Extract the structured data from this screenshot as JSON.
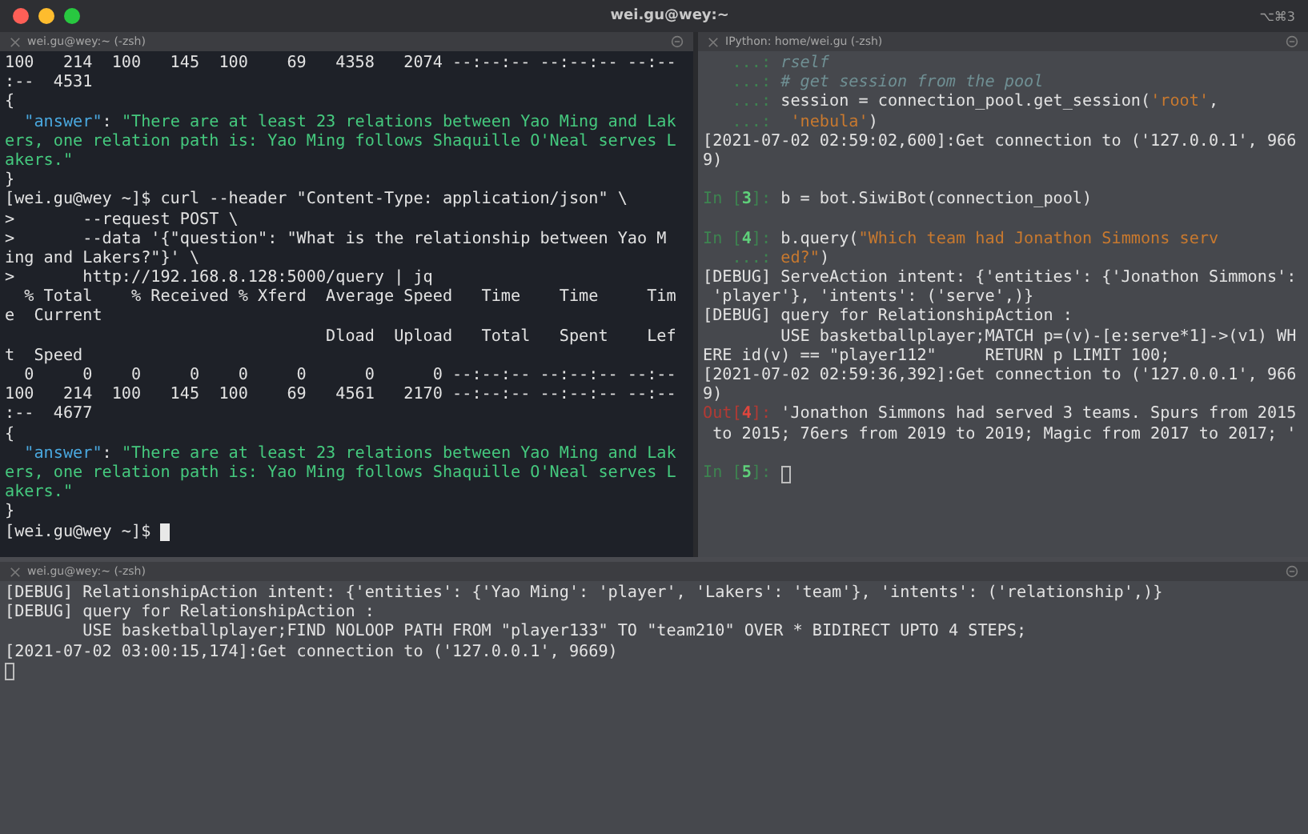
{
  "window": {
    "title": "wei.gu@wey:~",
    "shortcut": "⌥⌘3"
  },
  "panes": [
    {
      "kind": "dark",
      "tab_title": "wei.gu@wey:~ (-zsh)",
      "lines": [
        {
          "segments": [
            {
              "kind": "plain",
              "text": "100   214  100   145  100    69   4358   2074 --:--:-- --:--:-- --:--"
            }
          ]
        },
        {
          "segments": [
            {
              "kind": "plain",
              "text": ":--  4531"
            }
          ]
        },
        {
          "segments": [
            {
              "kind": "plain",
              "text": "{"
            }
          ]
        },
        {
          "segments": [
            {
              "kind": "key",
              "text": "  \"answer\""
            },
            {
              "kind": "plain",
              "text": ": "
            },
            {
              "kind": "string",
              "text": "\"There are at least 23 relations between Yao Ming and Lak"
            }
          ]
        },
        {
          "segments": [
            {
              "kind": "string",
              "text": "ers, one relation path is: Yao Ming follows Shaquille O'Neal serves L"
            }
          ]
        },
        {
          "segments": [
            {
              "kind": "string",
              "text": "akers.\""
            }
          ]
        },
        {
          "segments": [
            {
              "kind": "plain",
              "text": "}"
            }
          ]
        },
        {
          "segments": [
            {
              "kind": "plain",
              "text": "[wei.gu@wey ~]$ curl --header \"Content-Type: application/json\" \\"
            }
          ]
        },
        {
          "segments": [
            {
              "kind": "plain",
              "text": ">       --request POST \\"
            }
          ]
        },
        {
          "segments": [
            {
              "kind": "plain",
              "text": ">       --data '{\"question\": \"What is the relationship between Yao M"
            }
          ]
        },
        {
          "segments": [
            {
              "kind": "plain",
              "text": "ing and Lakers?\"}' \\"
            }
          ]
        },
        {
          "segments": [
            {
              "kind": "plain",
              "text": ">       http://192.168.8.128:5000/query | jq"
            }
          ]
        },
        {
          "segments": [
            {
              "kind": "plain",
              "text": "  % Total    % Received % Xferd  Average Speed   Time    Time     Tim"
            }
          ]
        },
        {
          "segments": [
            {
              "kind": "plain",
              "text": "e  Current"
            }
          ]
        },
        {
          "segments": [
            {
              "kind": "plain",
              "text": "                                 Dload  Upload   Total   Spent    Lef"
            }
          ]
        },
        {
          "segments": [
            {
              "kind": "plain",
              "text": "t  Speed"
            }
          ]
        },
        {
          "segments": [
            {
              "kind": "plain",
              "text": "  0     0    0     0    0     0      0      0 --:--:-- --:--:-- --:--"
            }
          ]
        },
        {
          "segments": [
            {
              "kind": "plain",
              "text": "100   214  100   145  100    69   4561   2170 --:--:-- --:--:-- --:--"
            }
          ]
        },
        {
          "segments": [
            {
              "kind": "plain",
              "text": ":--  4677"
            }
          ]
        },
        {
          "segments": [
            {
              "kind": "plain",
              "text": "{"
            }
          ]
        },
        {
          "segments": [
            {
              "kind": "key",
              "text": "  \"answer\""
            },
            {
              "kind": "plain",
              "text": ": "
            },
            {
              "kind": "string",
              "text": "\"There are at least 23 relations between Yao Ming and Lak"
            }
          ]
        },
        {
          "segments": [
            {
              "kind": "string",
              "text": "ers, one relation path is: Yao Ming follows Shaquille O'Neal serves L"
            }
          ]
        },
        {
          "segments": [
            {
              "kind": "string",
              "text": "akers.\""
            }
          ]
        },
        {
          "segments": [
            {
              "kind": "plain",
              "text": "}"
            }
          ]
        },
        {
          "kind": "block_cursor",
          "segments": [
            {
              "kind": "plain",
              "text": "[wei.gu@wey ~]$ "
            }
          ]
        }
      ]
    },
    {
      "kind": "gray",
      "tab_title": "IPython: home/wei.gu (-zsh)",
      "lines": [
        {
          "segments": [
            {
              "kind": "prompt",
              "text": "   ...: "
            },
            {
              "kind": "comment",
              "text": "rself"
            }
          ]
        },
        {
          "segments": [
            {
              "kind": "prompt",
              "text": "   ...: "
            },
            {
              "kind": "comment",
              "text": "# get session from the pool"
            }
          ]
        },
        {
          "segments": [
            {
              "kind": "prompt",
              "text": "   ...: "
            },
            {
              "kind": "plain",
              "text": "session = connection_pool.get_session("
            },
            {
              "kind": "literal",
              "text": "'root'"
            },
            {
              "kind": "plain",
              "text": ","
            }
          ]
        },
        {
          "segments": [
            {
              "kind": "prompt",
              "text": "   ...:  "
            },
            {
              "kind": "literal",
              "text": "'nebula'"
            },
            {
              "kind": "plain",
              "text": ")"
            }
          ]
        },
        {
          "segments": [
            {
              "kind": "plain",
              "text": "[2021-07-02 02:59:02,600]:Get connection to ('127.0.0.1', 966"
            }
          ]
        },
        {
          "segments": [
            {
              "kind": "plain",
              "text": "9)"
            }
          ]
        },
        {
          "kind": "blank"
        },
        {
          "segments": [
            {
              "kind": "prompt",
              "text": "In ["
            },
            {
              "kind": "prompt_num",
              "text": "3"
            },
            {
              "kind": "prompt",
              "text": "]: "
            },
            {
              "kind": "plain",
              "text": "b = bot.SiwiBot(connection_pool)"
            }
          ]
        },
        {
          "kind": "blank"
        },
        {
          "segments": [
            {
              "kind": "prompt",
              "text": "In ["
            },
            {
              "kind": "prompt_num",
              "text": "4"
            },
            {
              "kind": "prompt",
              "text": "]: "
            },
            {
              "kind": "plain",
              "text": "b.query("
            },
            {
              "kind": "literal",
              "text": "\"Which team had Jonathon Simmons serv"
            }
          ]
        },
        {
          "segments": [
            {
              "kind": "prompt",
              "text": "   ...: "
            },
            {
              "kind": "literal",
              "text": "ed?\""
            },
            {
              "kind": "plain",
              "text": ")"
            }
          ]
        },
        {
          "segments": [
            {
              "kind": "plain",
              "text": "[DEBUG] ServeAction intent: {'entities': {'Jonathon Simmons':"
            }
          ]
        },
        {
          "segments": [
            {
              "kind": "plain",
              "text": " 'player'}, 'intents': ('serve',)}"
            }
          ]
        },
        {
          "segments": [
            {
              "kind": "plain",
              "text": "[DEBUG] query for RelationshipAction :"
            }
          ]
        },
        {
          "segments": [
            {
              "kind": "plain",
              "text": "        USE basketballplayer;MATCH p=(v)-[e:serve*1]->(v1) WH"
            }
          ]
        },
        {
          "segments": [
            {
              "kind": "plain",
              "text": "ERE id(v) == \"player112\"     RETURN p LIMIT 100;"
            }
          ]
        },
        {
          "segments": [
            {
              "kind": "plain",
              "text": "[2021-07-02 02:59:36,392]:Get connection to ('127.0.0.1', 966"
            }
          ]
        },
        {
          "segments": [
            {
              "kind": "plain",
              "text": "9)"
            }
          ]
        },
        {
          "segments": [
            {
              "kind": "out",
              "text": "Out["
            },
            {
              "kind": "out_num",
              "text": "4"
            },
            {
              "kind": "out",
              "text": "]: "
            },
            {
              "kind": "plain",
              "text": "'Jonathon Simmons had served 3 teams. Spurs from 2015"
            }
          ]
        },
        {
          "segments": [
            {
              "kind": "plain",
              "text": " to 2015; 76ers from 2019 to 2019; Magic from 2017 to 2017; '"
            }
          ]
        },
        {
          "kind": "blank"
        },
        {
          "kind": "outline_cursor",
          "segments": [
            {
              "kind": "prompt",
              "text": "In ["
            },
            {
              "kind": "prompt_num",
              "text": "5"
            },
            {
              "kind": "prompt",
              "text": "]: "
            }
          ]
        }
      ]
    },
    {
      "kind": "gray",
      "tab_title": "wei.gu@wey:~ (-zsh)",
      "lines": [
        {
          "segments": [
            {
              "kind": "plain",
              "text": "[DEBUG] RelationshipAction intent: {'entities': {'Yao Ming': 'player', 'Lakers': 'team'}, 'intents': ('relationship',)}"
            }
          ]
        },
        {
          "segments": [
            {
              "kind": "plain",
              "text": "[DEBUG] query for RelationshipAction :"
            }
          ]
        },
        {
          "segments": [
            {
              "kind": "plain",
              "text": "        USE basketballplayer;FIND NOLOOP PATH FROM \"player133\" TO \"team210\" OVER * BIDIRECT UPTO 4 STEPS;"
            }
          ]
        },
        {
          "segments": [
            {
              "kind": "plain",
              "text": "[2021-07-02 03:00:15,174]:Get connection to ('127.0.0.1', 9669)"
            }
          ]
        },
        {
          "kind": "outline_cursor"
        }
      ]
    }
  ]
}
